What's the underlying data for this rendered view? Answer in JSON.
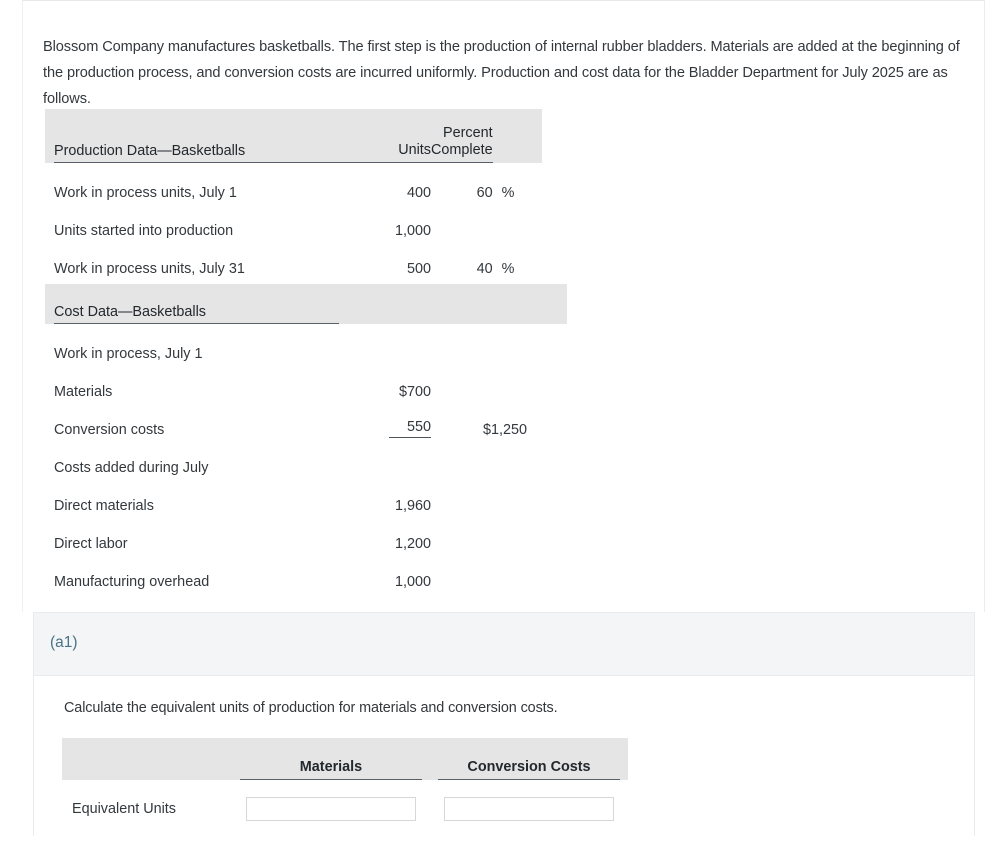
{
  "intro": {
    "paragraph": "Blossom Company manufactures basketballs. The first step is the production of internal rubber bladders. Materials are added at the beginning of the production process, and conversion costs are incurred uniformly. Production and cost data for the Bladder Department for July 2025 are as follows."
  },
  "production_table": {
    "header": {
      "title": "Production Data—Basketballs",
      "units": "Units",
      "percent_top": "Percent",
      "percent_bottom": "Complete"
    },
    "rows": [
      {
        "label": "Work in process units, July 1",
        "units": "400",
        "percent": "60",
        "symbol": "%"
      },
      {
        "label": "Units started into production",
        "units": "1,000",
        "percent": "",
        "symbol": ""
      },
      {
        "label": "Work in process units, July 31",
        "units": "500",
        "percent": "40",
        "symbol": "%"
      }
    ]
  },
  "cost_table": {
    "header": {
      "title": "Cost Data—Basketballs"
    },
    "rows": [
      {
        "label": "Work in process, July 1",
        "indent": 0,
        "amount": "",
        "total": ""
      },
      {
        "label": "Materials",
        "indent": 1,
        "amount": "$700",
        "total": ""
      },
      {
        "label": "Conversion costs",
        "indent": 1,
        "amount": "550",
        "total": "$1,250"
      },
      {
        "label": "Costs added during July",
        "indent": 0,
        "amount": "",
        "total": ""
      },
      {
        "label": "Direct materials",
        "indent": 0,
        "amount": "1,960",
        "total": ""
      },
      {
        "label": "Direct labor",
        "indent": 0,
        "amount": "1,200",
        "total": ""
      },
      {
        "label": "Manufacturing overhead",
        "indent": 0,
        "amount": "1,000",
        "total": ""
      }
    ]
  },
  "question": {
    "part_label": "(a1)",
    "prompt": "Calculate the equivalent units of production for materials and conversion costs.",
    "answer_table": {
      "col_materials": "Materials",
      "col_conversion": "Conversion Costs",
      "row_label": "Equivalent Units",
      "materials_value": "",
      "conversion_value": "",
      "input_placeholder": ""
    }
  },
  "colors": {
    "accent": "#4a7286",
    "band": "#e5e5e5",
    "card_head": "#f4f5f6",
    "text": "#33383d",
    "rule": "#58606a"
  }
}
